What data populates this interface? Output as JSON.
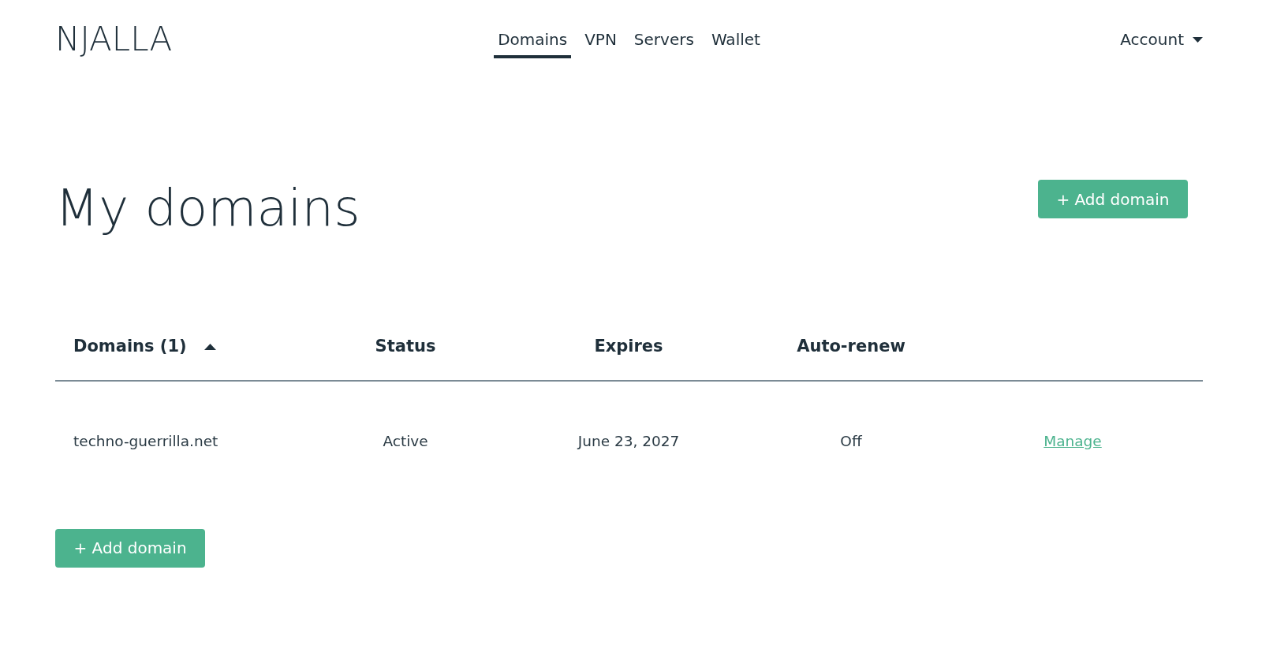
{
  "logo": {
    "text": "NJALLA"
  },
  "nav": {
    "items": [
      {
        "label": "Domains",
        "selected": true
      },
      {
        "label": "VPN",
        "selected": false
      },
      {
        "label": "Servers",
        "selected": false
      },
      {
        "label": "Wallet",
        "selected": false
      }
    ]
  },
  "account_menu": {
    "label": "Account"
  },
  "page": {
    "title": "My domains",
    "add_button": "+ Add domain"
  },
  "table": {
    "columns": [
      {
        "label": "Domains (1)",
        "sorted_ascending": true
      },
      {
        "label": "Status"
      },
      {
        "label": "Expires"
      },
      {
        "label": "Auto-renew"
      }
    ],
    "rows": [
      {
        "domain": "techno-guerrilla.net",
        "status": "Active",
        "expires": "June 23, 2027",
        "auto_renew": "Off",
        "action": "Manage"
      }
    ]
  },
  "footer_add_button": "+ Add domain"
}
